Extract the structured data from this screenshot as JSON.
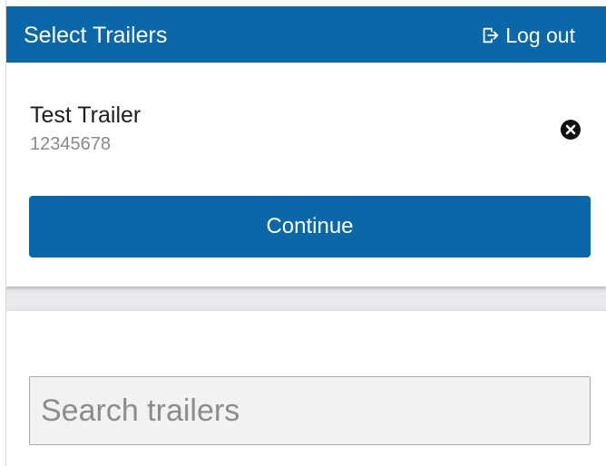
{
  "header": {
    "title": "Select Trailers",
    "logout_label": "Log out",
    "logout_icon": "log-out-icon",
    "background": "#0b68a8"
  },
  "selected_trailer": {
    "name": "Test Trailer",
    "number": "12345678",
    "remove_icon": "close-circle-icon"
  },
  "actions": {
    "continue_label": "Continue",
    "accent": "#0b68a8"
  },
  "search": {
    "placeholder": "Search trailers",
    "value": ""
  }
}
